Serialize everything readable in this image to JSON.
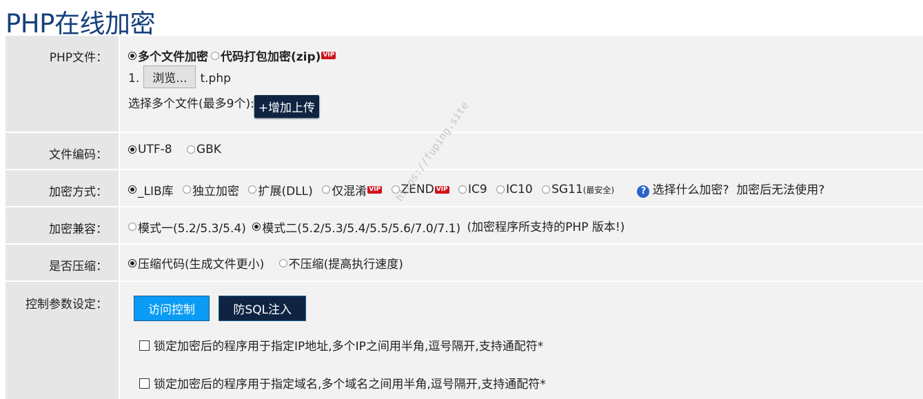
{
  "title": "PHP在线加密",
  "rows": {
    "file": {
      "label": "PHP文件：",
      "mode_multi": "多个文件加密",
      "mode_zip": "代码打包加密(zip)",
      "vip": "VIP",
      "index": "1.",
      "browse": "浏览...",
      "filename": "t.php",
      "select_hint": "选择多个文件(最多9个):",
      "add_upload": "+增加上传"
    },
    "encoding": {
      "label": "文件编码：",
      "options": [
        "UTF-8",
        "GBK"
      ]
    },
    "method": {
      "label": "加密方式：",
      "options": [
        "_LIB库",
        "独立加密",
        "扩展(DLL)",
        "仅混淆",
        "ZEND",
        "IC9",
        "IC10",
        "SG11"
      ],
      "sg11_note": "(最安全)",
      "vip": "VIP",
      "help_icon": "?",
      "help_text": "选择什么加密?",
      "help_text2": "加密后无法使用?"
    },
    "compat": {
      "label": "加密兼容：",
      "options": [
        "模式一(5.2/5.3/5.4)",
        "模式二(5.2/5.3/5.4/5.5/5.6/7.0/7.1)"
      ],
      "note": "(加密程序所支持的PHP 版本!)"
    },
    "compress": {
      "label": "是否压缩：",
      "options": [
        "压缩代码(生成文件更小)",
        "不压缩(提高执行速度)"
      ]
    },
    "control": {
      "label": "控制参数设定：",
      "tabs": [
        "访问控制",
        "防SQL注入"
      ],
      "lock_ip": "锁定加密后的程序用于指定IP地址,多个IP之间用半角,逗号隔开,支持通配符*",
      "lock_domain": "锁定加密后的程序用于指定域名,多个域名之间用半角,逗号隔开,支持通配符*"
    }
  },
  "watermark": "https://fuping.site",
  "colors": {
    "title": "#15417c",
    "tab_active": "#0a9bf5",
    "tab_dark": "#0e2442",
    "vip": "#d0121b"
  }
}
